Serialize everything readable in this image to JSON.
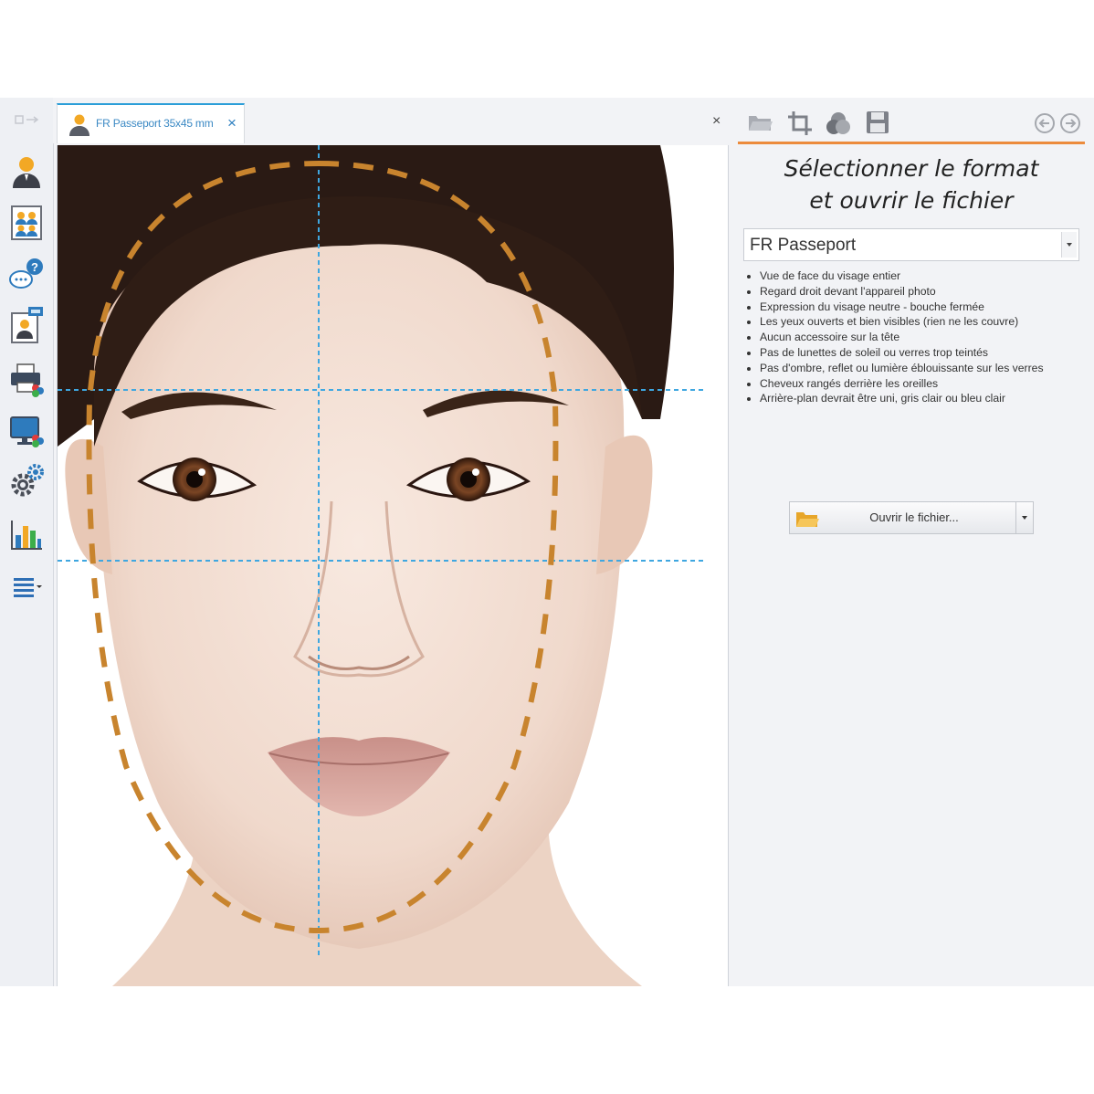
{
  "tab": {
    "label": "FR Passeport 35x45 mm",
    "close": "×"
  },
  "panel_close": "×",
  "sidebar": {
    "icons": [
      "person-icon",
      "group-photo-icon",
      "chat-help-icon",
      "new-profile-icon",
      "print-icon",
      "monitor-icon",
      "settings-icon",
      "chart-icon",
      "menu-icon"
    ]
  },
  "right_panel": {
    "toolbar": [
      "open-folder-icon",
      "crop-icon",
      "color-icon",
      "save-icon",
      "back-icon",
      "forward-icon"
    ],
    "title_line1": "Sélectionner le format",
    "title_line2": "et ouvrir le fichier",
    "format_select": {
      "value": "FR Passeport"
    },
    "requirements": [
      "Vue de face du visage entier",
      "Regard droit devant l'appareil photo",
      "Expression du visage neutre - bouche fermée",
      "Les yeux ouverts et bien visibles (rien ne les couvre)",
      "Aucun accessoire sur la tête",
      "Pas de lunettes de soleil ou verres trop teintés",
      "Pas d'ombre, reflet ou lumière éblouissante sur les verres",
      "Cheveux rangés derrière les oreilles",
      "Arrière-plan devrait être uni, gris clair ou bleu clair"
    ],
    "open_button": {
      "label": "Ouvrir le fichier..."
    }
  },
  "colors": {
    "accent": "#ec8b3c",
    "tab_accent": "#2c9ed8",
    "guide_oval": "#c8842e",
    "guide_lines": "#3fa7e0"
  }
}
